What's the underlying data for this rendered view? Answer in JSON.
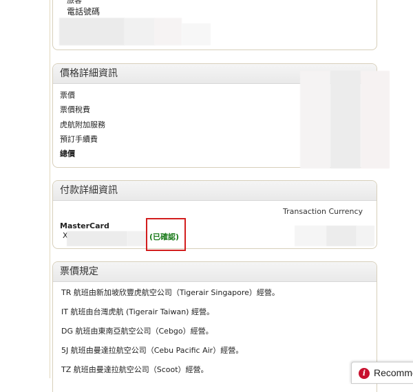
{
  "contact": {
    "cut_label": "旅客",
    "phone_label": "電話號碼"
  },
  "price": {
    "header": "價格詳細資訊",
    "rows": [
      "票價",
      "票價稅費",
      "虎航附加服務",
      "預訂手續費",
      "總價"
    ]
  },
  "payment": {
    "header": "付款詳細資訊",
    "currency_label": "Transaction Currency",
    "card_type": "MasterCard",
    "card_masked_prefix": "X",
    "status": "(已確認)"
  },
  "fare": {
    "header": "票價規定",
    "lines": [
      "TR 航班由新加坡欣豐虎航空公司（Tigerair Singapore）經營。",
      "IT 航班由台灣虎航 (Tigerair Taiwan) 經營。",
      "DG 航班由東南亞航空公司（Cebgo）經營。",
      "5J 航班由曼達拉航空公司（Cebu Pacific Air）經營。",
      "TZ 航班由曼達拉航空公司（Scoot）經營。"
    ]
  },
  "recommend": {
    "label": "Recommend"
  },
  "colors": {
    "status_green": "#1a7a1a",
    "highlight_red": "#d21c1c",
    "panel_border": "#d7cfba"
  }
}
